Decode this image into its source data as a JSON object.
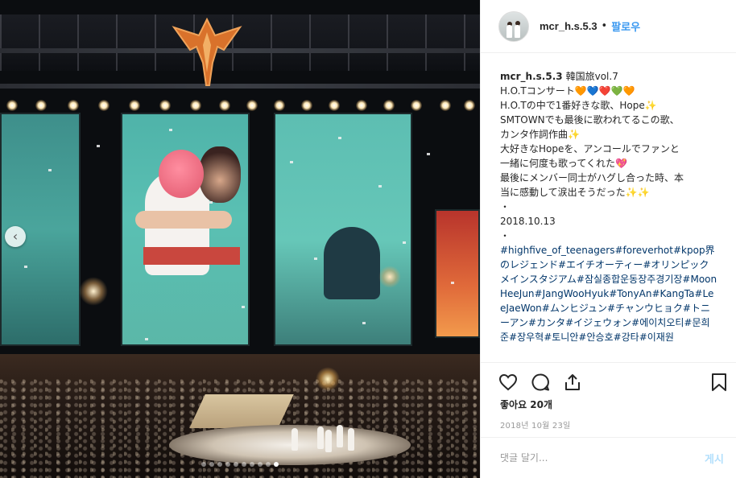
{
  "post": {
    "carousel": {
      "slide_count": 10,
      "active_index": 9,
      "prev_icon": "chevron-left-icon"
    },
    "header": {
      "username": "mcr_h.s.5.3",
      "separator": "•",
      "follow_label": "팔로우"
    },
    "caption": {
      "username": "mcr_h.s.5.3",
      "lines": [
        "韓国旅vol.7",
        "H.O.Tコンサート🧡💙❤️💚🧡",
        "H.O.Tの中で1番好きな歌、Hope✨",
        "SMTOWNでも最後に歌われてるこの歌、",
        "カンタ作詞作曲✨",
        "大好きなHopeを、アンコールでファンと",
        "一緒に何度も歌ってくれた💖",
        "最後にメンバー同士がハグし合った時、本",
        "当に感動して涙出そうだった✨✨",
        "・",
        "2018.10.13",
        "・"
      ],
      "hashtags": "#highfive_of_teenagers#foreverhot#kpop界のレジェンド#エイチオーティー#オリンピックメインスタジアム#잠실종합운동장주경기장#MoonHeeJun#JangWooHyuk#TonyAn#KangTa#LeeJaeWon#ムンヒジュン#チャンウヒョク#トニーアン#カンタ#イジェウォン#에이치오티#문희준#장우혁#토니안#안승호#강타#이재원"
    },
    "actions": {
      "like_icon": "heart-outline-icon",
      "comment_icon": "comment-bubble-icon",
      "share_icon": "share-arrow-icon",
      "save_icon": "bookmark-icon"
    },
    "likes_label": "좋아요 20개",
    "date_label": "2018년 10월 23일",
    "comment": {
      "placeholder": "댓글 달기...",
      "post_label": "게시"
    },
    "colors": {
      "link_blue": "#3897f0",
      "hashtag": "#003569",
      "post_button_disabled": "#b2dffc"
    }
  }
}
